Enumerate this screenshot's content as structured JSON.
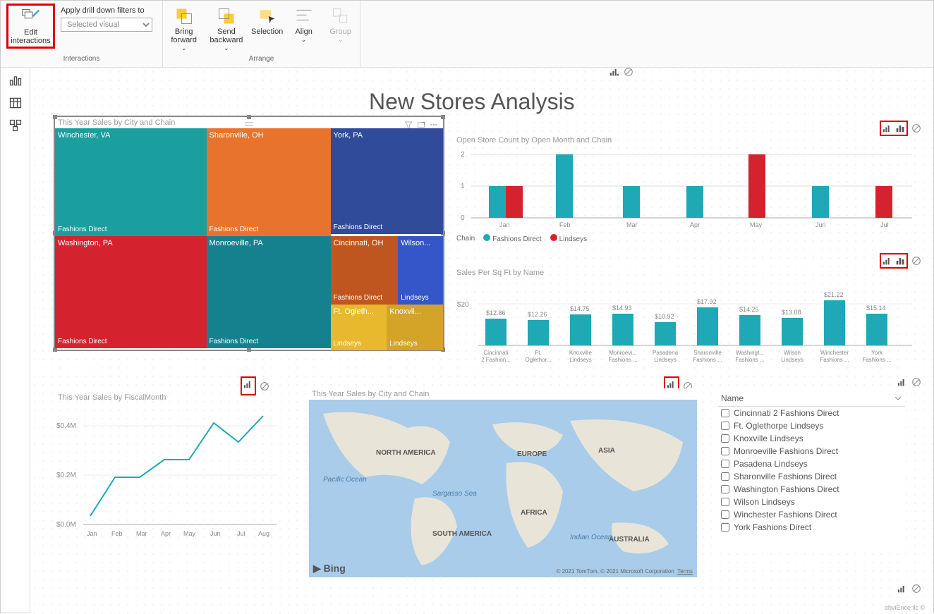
{
  "ribbon": {
    "edit_interactions": "Edit interactions",
    "drill_label": "Apply drill down filters to",
    "drill_placeholder": "Selected visual",
    "bring_forward": "Bring forward",
    "send_backward": "Send backward",
    "selection": "Selection",
    "align": "Align",
    "group": "Group",
    "group_interactions": "Interactions",
    "group_arrange": "Arrange"
  },
  "page_title": "New Stores Analysis",
  "treemap": {
    "title": "This Year Sales by City and Chain",
    "cells": [
      {
        "city": "Winchester, VA",
        "chain": "Fashions Direct"
      },
      {
        "city": "Sharonville, OH",
        "chain": "Fashions Direct"
      },
      {
        "city": "York, PA",
        "chain": "Fashions Direct"
      },
      {
        "city": "Washington, PA",
        "chain": "Fashions Direct"
      },
      {
        "city": "Monroeville, PA",
        "chain": "Fashions Direct"
      },
      {
        "city": "Cincinnati, OH",
        "chain": "Fashions Direct"
      },
      {
        "city": "Wilson...",
        "chain": "Lindseys"
      },
      {
        "city": "Ft. Ogleth...",
        "chain": "Lindseys"
      },
      {
        "city": "Knoxvil...",
        "chain": "Lindseys"
      }
    ]
  },
  "column_chart": {
    "title": "Open Store Count by Open Month and Chain",
    "legend_label": "Chain",
    "legend": [
      "Fashions Direct",
      "Lindseys"
    ]
  },
  "bar_chart": {
    "title": "Sales Per Sq Ft by Name"
  },
  "line_chart": {
    "title": "This Year Sales by FiscalMonth"
  },
  "map": {
    "title": "This Year Sales by City and Chain",
    "attribution": "© 2021 TomTom, © 2021 Microsoft Corporation",
    "terms": "Terms",
    "bing": "Bing",
    "labels": {
      "na": "NORTH AMERICA",
      "sa": "SOUTH AMERICA",
      "eu": "EUROPE",
      "af": "AFRICA",
      "as": "ASIA",
      "au": "AUSTRALIA",
      "po": "Pacific Ocean",
      "so": "Sargasso Sea",
      "io": "Indian Ocean"
    }
  },
  "slicer": {
    "header": "Name",
    "items": [
      "Cincinnati 2 Fashions Direct",
      "Ft. Oglethorpe Lindseys",
      "Knoxville Lindseys",
      "Monroeville Fashions Direct",
      "Pasadena Lindseys",
      "Sharonville Fashions Direct",
      "Washington Fashions Direct",
      "Wilson Lindseys",
      "Winchester Fashions Direct",
      "York Fashions Direct"
    ]
  },
  "footer": "obviEnce llc ©",
  "chart_data": [
    {
      "type": "bar",
      "title": "Open Store Count by Open Month and Chain",
      "categories": [
        "Jan",
        "Feb",
        "Mar",
        "Apr",
        "May",
        "Jun",
        "Jul"
      ],
      "series": [
        {
          "name": "Fashions Direct",
          "values": [
            1,
            2,
            1,
            1,
            0,
            1,
            0
          ]
        },
        {
          "name": "Lindseys",
          "values": [
            1,
            0,
            0,
            0,
            2,
            0,
            1
          ]
        }
      ],
      "ylim": [
        0,
        2
      ]
    },
    {
      "type": "bar",
      "title": "Sales Per Sq Ft by Name",
      "categories": [
        "Cincinnati 2 Fashion...",
        "Ft. Oglethor...",
        "Knoxville Lindseys",
        "Monroevi... Fashions ...",
        "Pasadena Lindseys",
        "Sharonville Fashions ...",
        "Washingt... Fashions ...",
        "Wilson Lindseys",
        "Winchester Fashions ...",
        "York Fashions ..."
      ],
      "values": [
        12.86,
        12.26,
        14.75,
        14.93,
        10.92,
        17.92,
        14.25,
        13.08,
        21.22,
        15.14
      ],
      "ylim": [
        0,
        22
      ],
      "ylabel": "$"
    },
    {
      "type": "line",
      "title": "This Year Sales by FiscalMonth",
      "categories": [
        "Jan",
        "Feb",
        "Mar",
        "Apr",
        "May",
        "Jun",
        "Jul",
        "Aug"
      ],
      "values": [
        0.06,
        0.2,
        0.2,
        0.27,
        0.27,
        0.42,
        0.34,
        0.45
      ],
      "ylim": [
        0,
        0.5
      ],
      "ylabel": "M"
    }
  ]
}
